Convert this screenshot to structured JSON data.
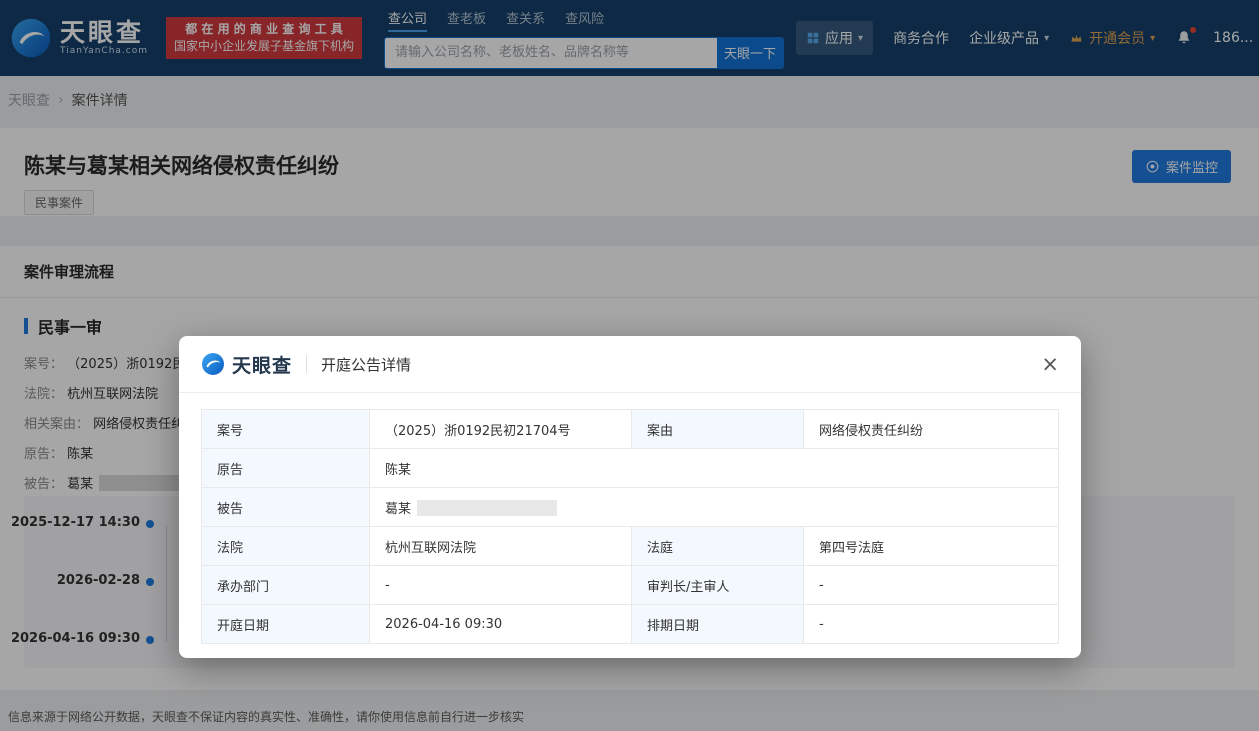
{
  "colors": {
    "navbar_bg": "#14406a",
    "brand_red": "#d23a40",
    "primary_blue": "#1373d6",
    "button_blue": "#1f7ce0",
    "vip_gold": "#dfa452",
    "label_cell_bg": "#f3f9fe"
  },
  "navbar": {
    "brand": "天眼查",
    "brand_domain": "TianYanCha.com",
    "badge_line1": "都 在 用 的 商 业 查 询 工 具",
    "badge_line2": "国家中小企业发展子基金旗下机构",
    "tabs": [
      "查公司",
      "查老板",
      "查关系",
      "查风险"
    ],
    "search_placeholder": "请输入公司名称、老板姓名、品牌名称等",
    "search_button": "天眼一下",
    "menu_apps": "应用",
    "menu_cooperation": "商务合作",
    "menu_enterprise": "企业级产品",
    "menu_vip": "开通会员",
    "phone": "186...",
    "caret": "▾"
  },
  "breadcrumb": {
    "home": "天眼查",
    "separator": "›",
    "current": "案件详情"
  },
  "case_header": {
    "title": "陈某与葛某相关网络侵权责任纠纷",
    "tag": "民事案件",
    "monitor_button": "案件监控"
  },
  "case_flow": {
    "section_title": "案件审理流程",
    "stage_title": "民事一审",
    "case_no_label": "案号：",
    "case_no_value": "（2025）浙0192民",
    "court_label": "法院：",
    "court_value": "杭州互联网法院",
    "cause_label": "相关案由：",
    "cause_value": "网络侵权责任纠",
    "plaintiff_label": "原告：",
    "plaintiff_value": "陈某",
    "defendant_label": "被告：",
    "defendant_value": "葛某",
    "timeline": [
      "2025-12-17 14:30",
      "2026-02-28",
      "2026-04-16 09:30"
    ]
  },
  "modal": {
    "brand": "天眼查",
    "title": "开庭公告详情",
    "close": "×",
    "table": {
      "case_no_label": "案号",
      "case_no_value": "（2025）浙0192民初21704号",
      "cause_label": "案由",
      "cause_value": "网络侵权责任纠纷",
      "plaintiff_label": "原告",
      "plaintiff_value": "陈某",
      "defendant_label": "被告",
      "defendant_value": "葛某",
      "court_label": "法院",
      "court_value": "杭州互联网法院",
      "courtroom_label": "法庭",
      "courtroom_value": "第四号法庭",
      "department_label": "承办部门",
      "department_value": "-",
      "judge_label": "审判长/主审人",
      "judge_value": "-",
      "hearing_date_label": "开庭日期",
      "hearing_date_value": "2026-04-16 09:30",
      "schedule_label": "排期日期",
      "schedule_value": "-"
    }
  },
  "footer": {
    "disclaimer": "信息来源于网络公开数据，天眼查不保证内容的真实性、准确性，请你使用信息前自行进一步核实"
  }
}
